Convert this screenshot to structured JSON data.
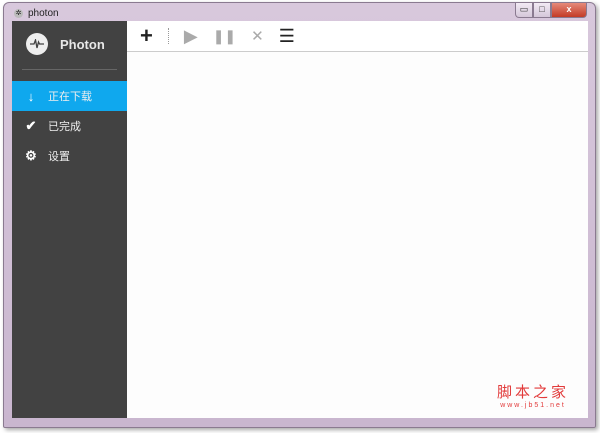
{
  "window": {
    "title": "photon",
    "minimize": "▭",
    "maximize": "□",
    "close": "x"
  },
  "sidebar": {
    "brand": "Photon",
    "items": [
      {
        "label": "正在下载",
        "icon": "arrow-down-icon",
        "active": true
      },
      {
        "label": "已完成",
        "icon": "check-icon",
        "active": false
      },
      {
        "label": "设置",
        "icon": "gear-icon",
        "active": false
      }
    ]
  },
  "toolbar": {
    "add": "+",
    "start": "▶",
    "pause": "❚❚",
    "delete": "✕",
    "list": "☰"
  },
  "watermark": {
    "title": "脚本之家",
    "url": "www.jb51.net"
  },
  "colors": {
    "accent": "#0fa8ee",
    "sidebar": "#424242"
  }
}
